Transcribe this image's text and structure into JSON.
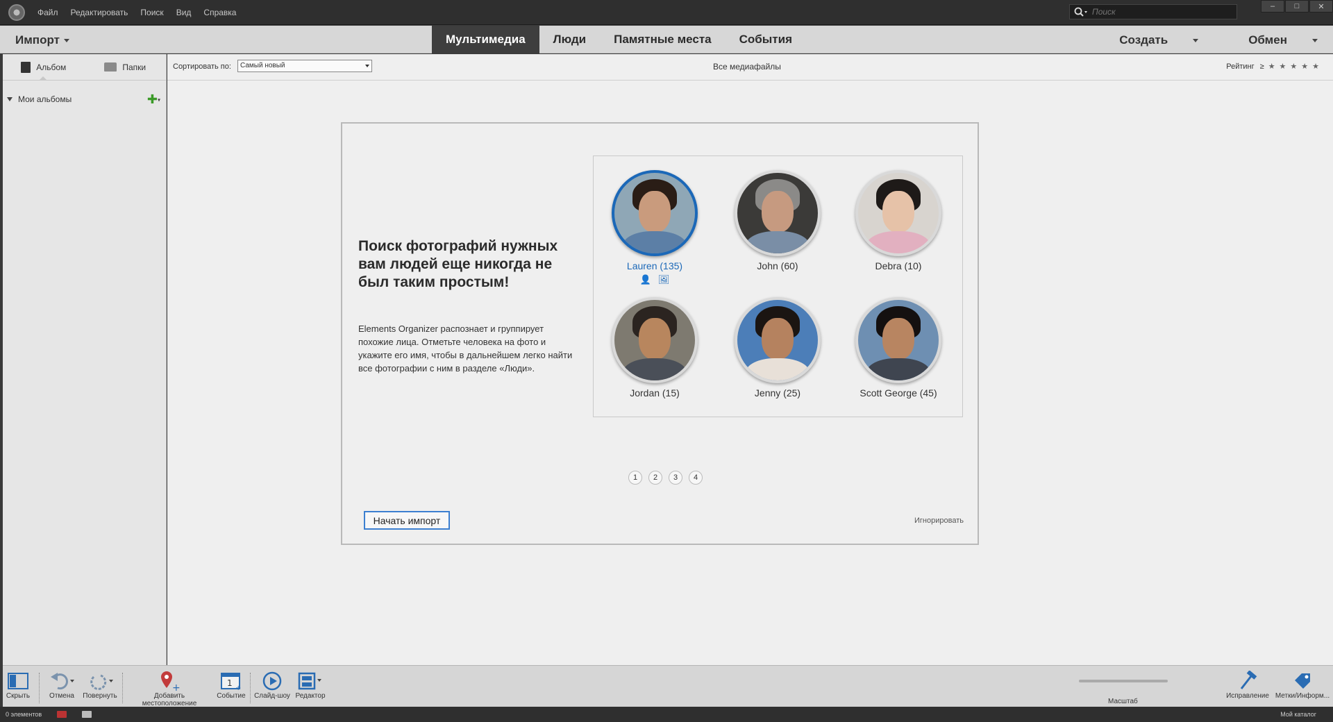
{
  "menu": [
    "Файл",
    "Редактировать",
    "Поиск",
    "Вид",
    "Справка"
  ],
  "search": {
    "placeholder": "Поиск"
  },
  "nav": {
    "import_label": "Импорт",
    "tabs": [
      "Мультимедиа",
      "Люди",
      "Памятные места",
      "События"
    ],
    "active_tab": "Мультимедиа",
    "create_label": "Создать",
    "share_label": "Обмен"
  },
  "left_panel": {
    "tabs": [
      "Альбом",
      "Папки"
    ],
    "albums_label": "Мои альбомы"
  },
  "sortbar": {
    "sort_label": "Сортировать по:",
    "sort_value": "Самый новый",
    "all_media": "Все медиафайлы",
    "rating_label": "Рейтинг",
    "rating_op": "≥",
    "stars": "★★★★★"
  },
  "card": {
    "headline": "Поиск фотографий нужных вам людей еще никогда не был таким простым!",
    "description": "Elements Organizer распознает и группирует похожие лица. Отметьте человека на фото и укажите его имя, чтобы в дальнейшем легко найти все фотографии с ним в разделе «Люди».",
    "faces": [
      {
        "name": "Lauren (135)",
        "selected": true
      },
      {
        "name": "John (60)",
        "selected": false
      },
      {
        "name": "Debra (10)",
        "selected": false
      },
      {
        "name": "Jordan (15)",
        "selected": false
      },
      {
        "name": "Jenny (25)",
        "selected": false
      },
      {
        "name": "Scott George (45)",
        "selected": false
      }
    ],
    "pages": [
      "1",
      "2",
      "3",
      "4"
    ],
    "start_button": "Начать импорт",
    "ignore_link": "Игнорировать"
  },
  "bottom": {
    "hide": "Скрыть",
    "undo": "Отмена",
    "rotate": "Повернуть",
    "add_location": "Добавить местоположение",
    "event": "Событие",
    "slideshow": "Слайд-шоу",
    "editor": "Редактор",
    "zoom": "Масштаб",
    "fix": "Исправление",
    "tags_info": "Метки/Информ..."
  },
  "status": {
    "count": "0 элементов",
    "catalog": "Мой каталог"
  },
  "colors": {
    "accent": "#1b68b8",
    "active_tab": "#3e3e3e",
    "green_plus": "#3b9a28"
  }
}
